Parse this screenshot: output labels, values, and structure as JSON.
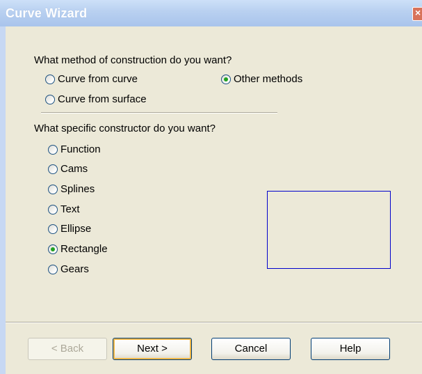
{
  "window": {
    "title": "Curve Wizard",
    "close_glyph": "×"
  },
  "construction": {
    "question": "What method of construction do you want?",
    "options": [
      {
        "label": "Curve from curve",
        "selected": false
      },
      {
        "label": "Other methods",
        "selected": true
      },
      {
        "label": "Curve from surface",
        "selected": false
      }
    ]
  },
  "constructor": {
    "question": "What specific constructor do you want?",
    "options": [
      {
        "label": "Function",
        "selected": false
      },
      {
        "label": "Cams",
        "selected": false
      },
      {
        "label": "Splines",
        "selected": false
      },
      {
        "label": "Text",
        "selected": false
      },
      {
        "label": "Ellipse",
        "selected": false
      },
      {
        "label": "Rectangle",
        "selected": true
      },
      {
        "label": "Gears",
        "selected": false
      }
    ]
  },
  "buttons": {
    "back": "< Back",
    "next": "Next >",
    "cancel": "Cancel",
    "help": "Help"
  },
  "colors": {
    "preview_border": "#0000cc",
    "radio_dot": "#21a121"
  }
}
